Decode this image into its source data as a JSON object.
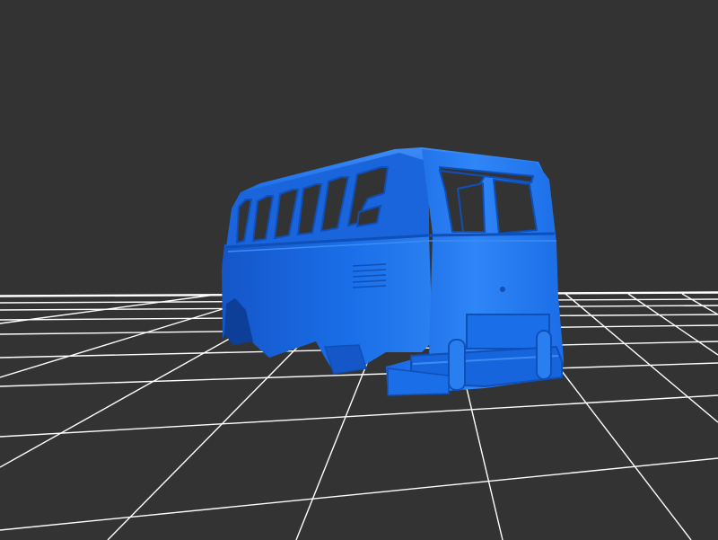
{
  "viewport": {
    "background_color": "#333333",
    "grid_color": "#ffffff",
    "model_color": "#1a6ee8",
    "model_dark_color": "#0f4fb8",
    "model_light_color": "#3d8cf5"
  },
  "model": {
    "subject": "van-body-shell",
    "view": "rear-three-quarter"
  }
}
